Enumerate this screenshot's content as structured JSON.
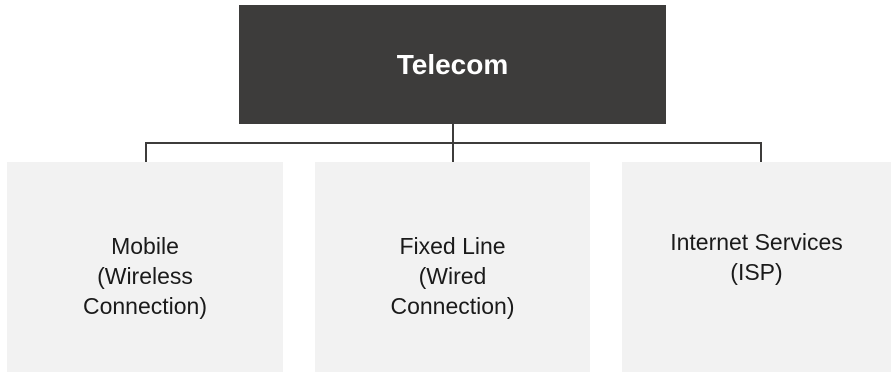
{
  "root": {
    "label": "Telecom",
    "color": "#3d3c3b"
  },
  "children": [
    {
      "label": "Mobile\n(Wireless\nConnection)"
    },
    {
      "label": "Fixed Line\n(Wired\nConnection)"
    },
    {
      "label": "Internet Services\n(ISP)"
    }
  ],
  "child_color": "#f2f2f2",
  "connector_color": "#3d3c3b"
}
